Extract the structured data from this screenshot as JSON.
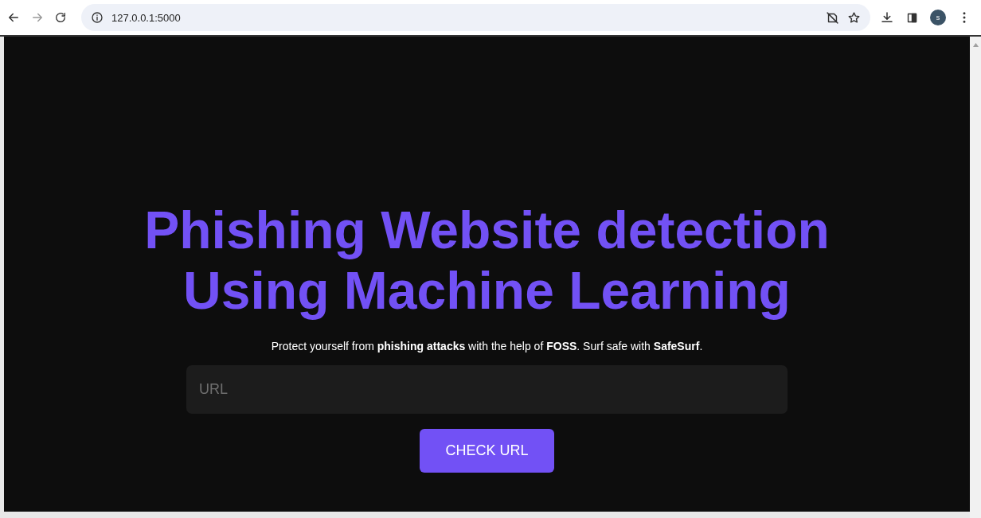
{
  "browser": {
    "url": "127.0.0.1:5000",
    "profile_initial": "s"
  },
  "page": {
    "title": "Phishing Website detection Using Machine Learning",
    "tagline": "Protect yourself from **phishing attacks** with the help of **FOSS**. Surf safe with **SafeSurf**.",
    "url_field": {
      "placeholder": "URL"
    },
    "button": "CHECK URL"
  }
}
